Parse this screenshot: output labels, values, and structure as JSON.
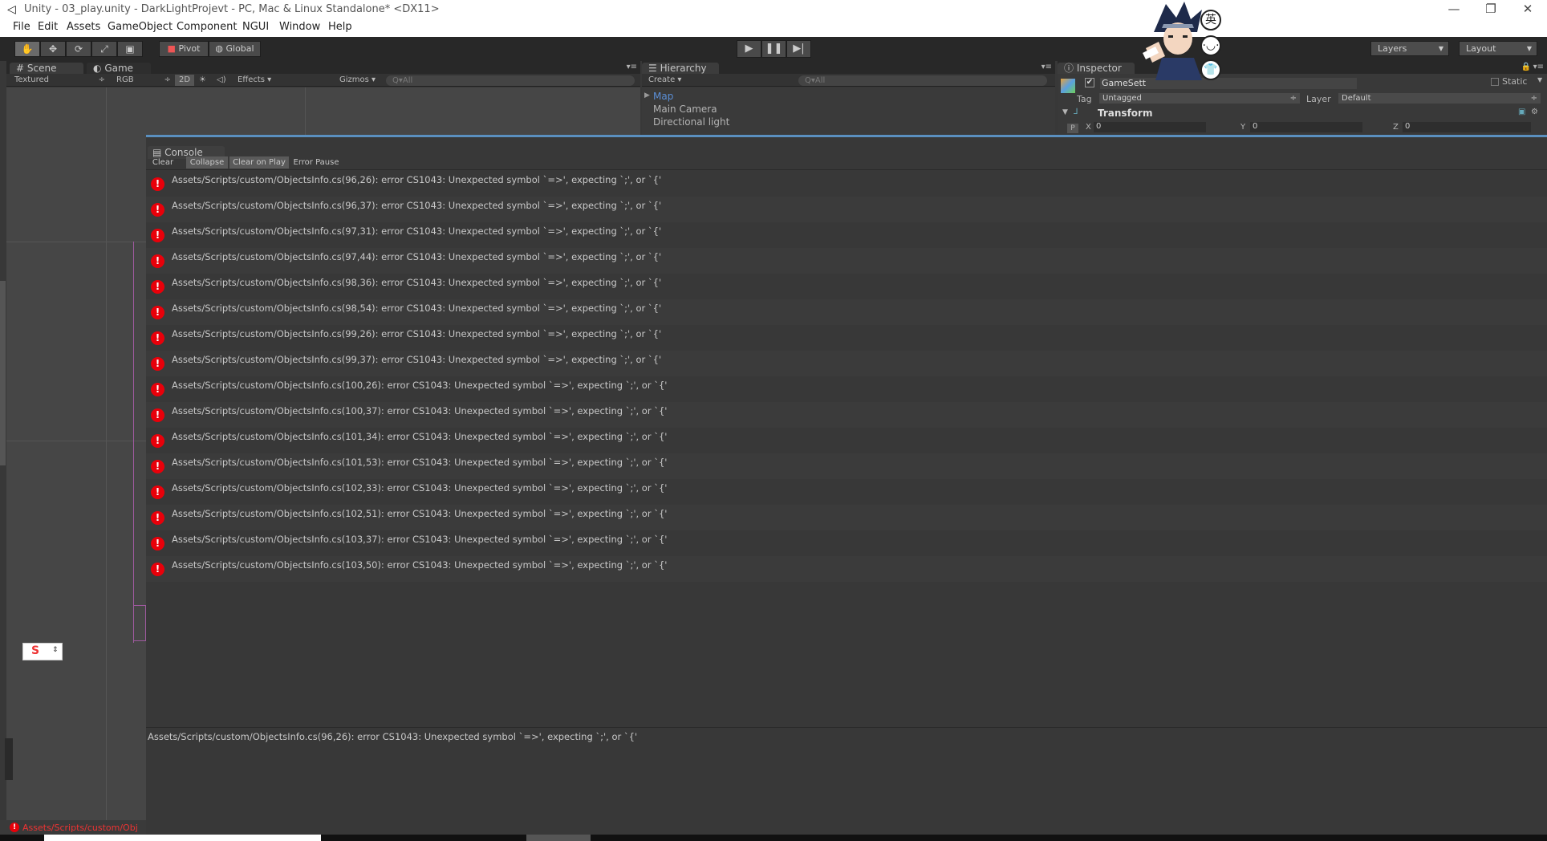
{
  "window": {
    "title": "Unity - 03_play.unity - DarkLightProjevt - PC, Mac & Linux Standalone* <DX11>",
    "controls": [
      "—",
      "❐",
      "✕"
    ]
  },
  "menu": [
    "File",
    "Edit",
    "Assets",
    "GameObject",
    "Component",
    "NGUI",
    "Window",
    "Help"
  ],
  "toolbar": {
    "tools": [
      "hand-icon",
      "move-icon",
      "rotate-icon",
      "scale-icon",
      "rect-icon"
    ],
    "pivot": "Pivot",
    "global": "Global",
    "layers": "Layers",
    "layout": "Layout"
  },
  "scene": {
    "tab_scene": "Scene",
    "tab_game": "Game",
    "shading": "Textured",
    "render": "RGB",
    "mode_2d": "2D",
    "effects": "Effects",
    "gizmos": "Gizmos",
    "search_placeholder": "Q▾All"
  },
  "hierarchy": {
    "tab": "Hierarchy",
    "create": "Create",
    "search_placeholder": "Q▾All",
    "items": [
      "Map",
      "Main Camera",
      "Directional light"
    ]
  },
  "inspector": {
    "tab": "Inspector",
    "object_name": "GameSett",
    "static": "Static",
    "tag_label": "Tag",
    "tag_value": "Untagged",
    "layer_label": "Layer",
    "layer_value": "Default",
    "component": "Transform",
    "p_label": "P",
    "x_label": "X",
    "x_value": "0",
    "y_label": "Y",
    "y_value": "0",
    "z_label": "Z",
    "z_value": "0"
  },
  "ime": {
    "lang": "英"
  },
  "console": {
    "tab": "Console",
    "buttons": [
      "Clear",
      "Collapse",
      "Clear on Play",
      "Error Pause"
    ],
    "messages": [
      "Assets/Scripts/custom/ObjectsInfo.cs(96,26): error CS1043: Unexpected symbol `=>', expecting `;', or `{'",
      "Assets/Scripts/custom/ObjectsInfo.cs(96,37): error CS1043: Unexpected symbol `=>', expecting `;', or `{'",
      "Assets/Scripts/custom/ObjectsInfo.cs(97,31): error CS1043: Unexpected symbol `=>', expecting `;', or `{'",
      "Assets/Scripts/custom/ObjectsInfo.cs(97,44): error CS1043: Unexpected symbol `=>', expecting `;', or `{'",
      "Assets/Scripts/custom/ObjectsInfo.cs(98,36): error CS1043: Unexpected symbol `=>', expecting `;', or `{'",
      "Assets/Scripts/custom/ObjectsInfo.cs(98,54): error CS1043: Unexpected symbol `=>', expecting `;', or `{'",
      "Assets/Scripts/custom/ObjectsInfo.cs(99,26): error CS1043: Unexpected symbol `=>', expecting `;', or `{'",
      "Assets/Scripts/custom/ObjectsInfo.cs(99,37): error CS1043: Unexpected symbol `=>', expecting `;', or `{'",
      "Assets/Scripts/custom/ObjectsInfo.cs(100,26): error CS1043: Unexpected symbol `=>', expecting `;', or `{'",
      "Assets/Scripts/custom/ObjectsInfo.cs(100,37): error CS1043: Unexpected symbol `=>', expecting `;', or `{'",
      "Assets/Scripts/custom/ObjectsInfo.cs(101,34): error CS1043: Unexpected symbol `=>', expecting `;', or `{'",
      "Assets/Scripts/custom/ObjectsInfo.cs(101,53): error CS1043: Unexpected symbol `=>', expecting `;', or `{'",
      "Assets/Scripts/custom/ObjectsInfo.cs(102,33): error CS1043: Unexpected symbol `=>', expecting `;', or `{'",
      "Assets/Scripts/custom/ObjectsInfo.cs(102,51): error CS1043: Unexpected symbol `=>', expecting `;', or `{'",
      "Assets/Scripts/custom/ObjectsInfo.cs(103,37): error CS1043: Unexpected symbol `=>', expecting `;', or `{'",
      "Assets/Scripts/custom/ObjectsInfo.cs(103,50): error CS1043: Unexpected symbol `=>', expecting `;', or `{'"
    ],
    "detail": "Assets/Scripts/custom/ObjectsInfo.cs(96,26): error CS1043: Unexpected symbol `=>', expecting `;', or `{'"
  },
  "statusbar": {
    "text": "Assets/Scripts/custom/Obj"
  },
  "colors": {
    "error": "#e8000a",
    "console_accent": "#5a8fbf",
    "hier_selected": "#5b8fd6"
  }
}
